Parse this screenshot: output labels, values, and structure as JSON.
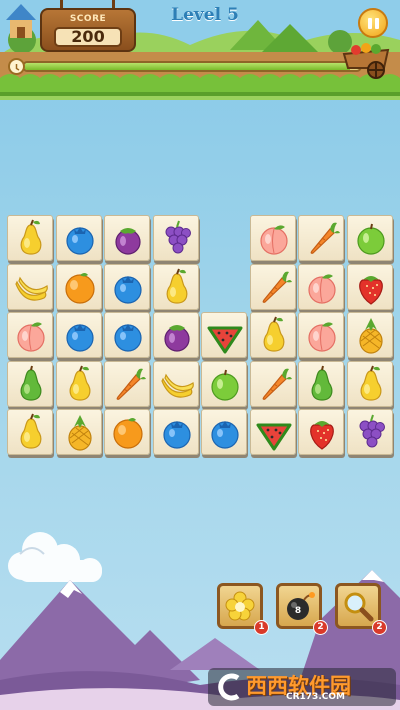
{
  "header": {
    "score_label": "SCORE",
    "score_value": "200",
    "level_title": "Level 5",
    "timer_progress": 0.97
  },
  "board": {
    "rows": [
      [
        "pear",
        "blueberry",
        "eggplant",
        "grapes",
        "",
        "peach",
        "carrot",
        "green-apple"
      ],
      [
        "banana",
        "orange",
        "blueberry",
        "pear",
        "",
        "carrot",
        "peach",
        "strawberry"
      ],
      [
        "peach",
        "blueberry",
        "blueberry",
        "eggplant",
        "watermelon",
        "pear",
        "peach",
        "pineapple"
      ],
      [
        "green-pear",
        "pear",
        "carrot",
        "banana",
        "green-apple",
        "carrot",
        "green-pear",
        "pear"
      ],
      [
        "pear",
        "pineapple",
        "orange",
        "blueberry",
        "blueberry",
        "watermelon",
        "strawberry",
        "grapes"
      ]
    ]
  },
  "tools": [
    {
      "name": "flower-hint",
      "count": "1"
    },
    {
      "name": "bomb",
      "count": "2"
    },
    {
      "name": "magnifier",
      "count": "2"
    }
  ],
  "watermark": {
    "brand": "西西软件园",
    "url": "CR173.COM"
  },
  "colors": {
    "sky": "#9fd4ea",
    "grass": "#77c13a",
    "wood": "#8a4f1d",
    "tile": "#f6ecd2",
    "title": "#2d7fb6"
  }
}
